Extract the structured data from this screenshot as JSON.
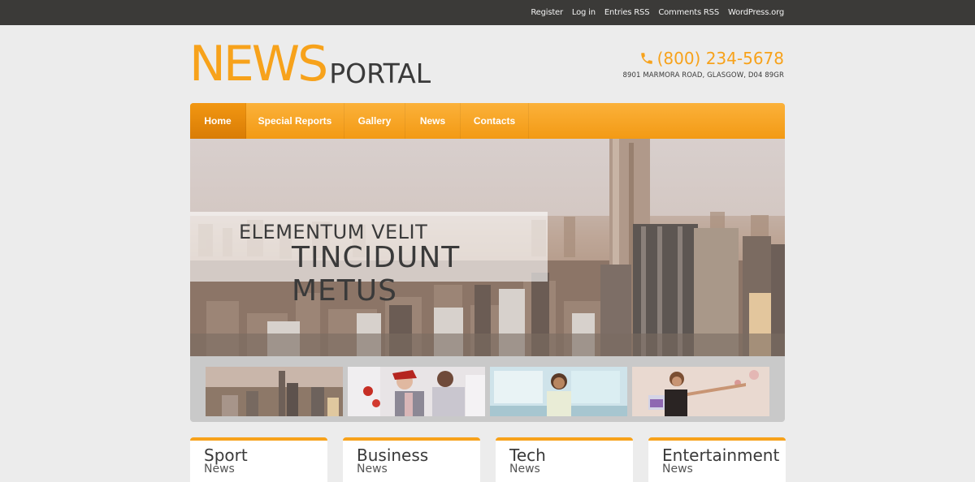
{
  "top_links": [
    "Register",
    "Log in",
    "Entries RSS",
    "Comments RSS",
    "WordPress.org"
  ],
  "logo": {
    "big": "NEWS",
    "small": "PORTAL"
  },
  "contact": {
    "phone": "(800) 234-5678",
    "address": "8901 MARMORA ROAD, GLASGOW, D04 89GR"
  },
  "nav": [
    "Home",
    "Special Reports",
    "Gallery",
    "News",
    "Contacts"
  ],
  "hero": {
    "line1": "ELEMENTUM VELIT",
    "line2": "TINCIDUNT METUS"
  },
  "cards": [
    {
      "title": "Sport",
      "subtitle": "News"
    },
    {
      "title": "Business",
      "subtitle": "News"
    },
    {
      "title": "Tech",
      "subtitle": "News"
    },
    {
      "title": "Entertainment",
      "subtitle": "News"
    }
  ],
  "colors": {
    "accent": "#f7a21b",
    "topbar": "#3b3a38",
    "background": "#ececec"
  }
}
